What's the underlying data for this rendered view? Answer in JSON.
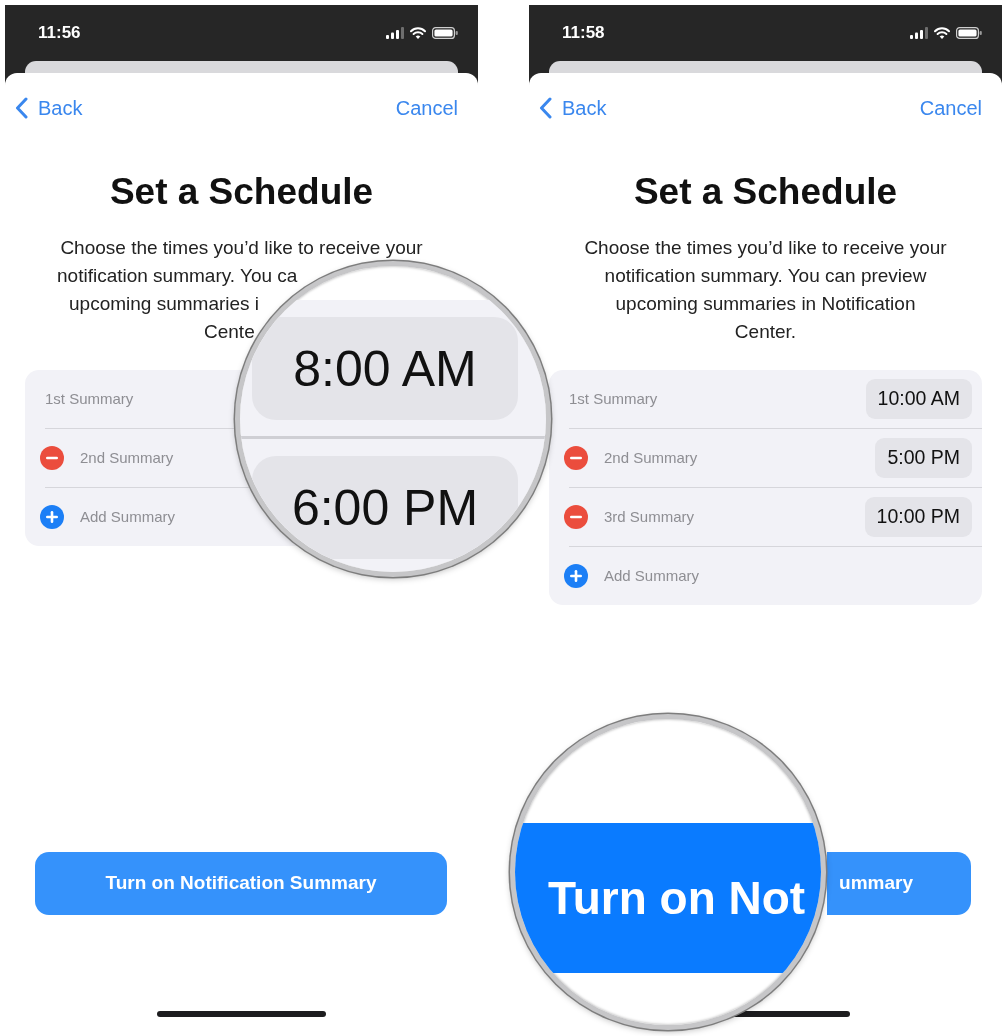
{
  "phones": [
    {
      "status_bar": {
        "time": "11:56"
      },
      "nav": {
        "back": "Back",
        "cancel": "Cancel"
      },
      "title": "Set a Schedule",
      "description_lines": [
        "Choose the times you’d like to receive your",
        "notification summary. You ca",
        "upcoming summaries i",
        "Cente"
      ],
      "summaries": [
        {
          "kind": "fixed",
          "label": "1st Summary"
        },
        {
          "kind": "removable",
          "label": "2nd Summary"
        },
        {
          "kind": "add",
          "label": "Add Summary"
        }
      ],
      "button": "Turn on Notification Summary",
      "magnifier": {
        "kind": "times",
        "times": [
          "8:00 AM",
          "6:00 PM"
        ]
      }
    },
    {
      "status_bar": {
        "time": "11:58"
      },
      "nav": {
        "back": "Back",
        "cancel": "Cancel"
      },
      "title": "Set a Schedule",
      "description_lines": [
        "Choose the times you’d like to receive your",
        "notification summary. You can preview",
        "upcoming summaries in Notification",
        "Center."
      ],
      "summaries": [
        {
          "kind": "fixed",
          "label": "1st Summary",
          "time": "10:00 AM"
        },
        {
          "kind": "removable",
          "label": "2nd Summary",
          "time": "5:00 PM"
        },
        {
          "kind": "removable",
          "label": "3rd Summary",
          "time": "10:00 PM"
        },
        {
          "kind": "add",
          "label": "Add Summary"
        }
      ],
      "button": "ummary",
      "magnifier": {
        "kind": "button",
        "label": "Turn on Not"
      }
    }
  ]
}
